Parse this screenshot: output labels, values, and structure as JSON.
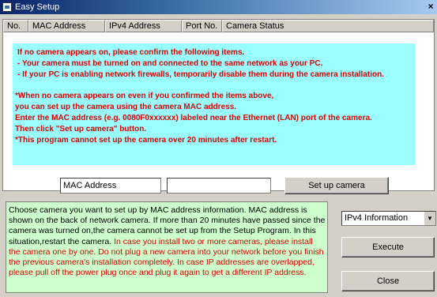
{
  "window": {
    "title": "Easy Setup",
    "close_glyph": "×",
    "app_icon": "window-icon"
  },
  "table": {
    "headers": [
      "No.",
      "MAC Address",
      "IPv4 Address",
      "Port No.",
      "Camera Status"
    ],
    "rows": []
  },
  "notice": {
    "lines": [
      "If no camera appears on, please confirm the following items.",
      " - Your camera must be turned on and connected to the same network as your PC.",
      " - If your PC is enabling network firewalls, temporarily disable them during the camera installation.",
      "*When no camera appears on even if you confirmed the items above,",
      "  you can set up the camera using the camera MAC address.",
      "  Enter the MAC address (e.g. 0080F0xxxxxx) labeled near the Ethernet (LAN) port of the camera.",
      "  Then click \"Set up camera\" button.",
      "*This program cannot set up the camera over 20 minutes after restart."
    ],
    "colors": {
      "background": "#99ffff",
      "text": "#e00000"
    }
  },
  "mac_entry": {
    "label": "MAC Address",
    "value": "",
    "setup_button": "Set up camera"
  },
  "help": {
    "black_text": "Choose camera you want to set up by MAC address information. MAC address is shown on the back of network camera. If more than 20 minutes have passed since the camera was turned on,the camera cannot be set up from the Setup Program. In this situation,restart the camera.",
    "red_text": "In case you install two or more cameras, please install the camera one by one. Do not plug a new camera into your network before you finish the previous camera's installation completely. In case IP addresses are overlapped, please pull off the power plug once and plug it again to get a different IP address.",
    "background": "#ccffcc"
  },
  "controls": {
    "info_select": "IPv4 Information",
    "execute_button": "Execute",
    "close_button": "Close"
  }
}
